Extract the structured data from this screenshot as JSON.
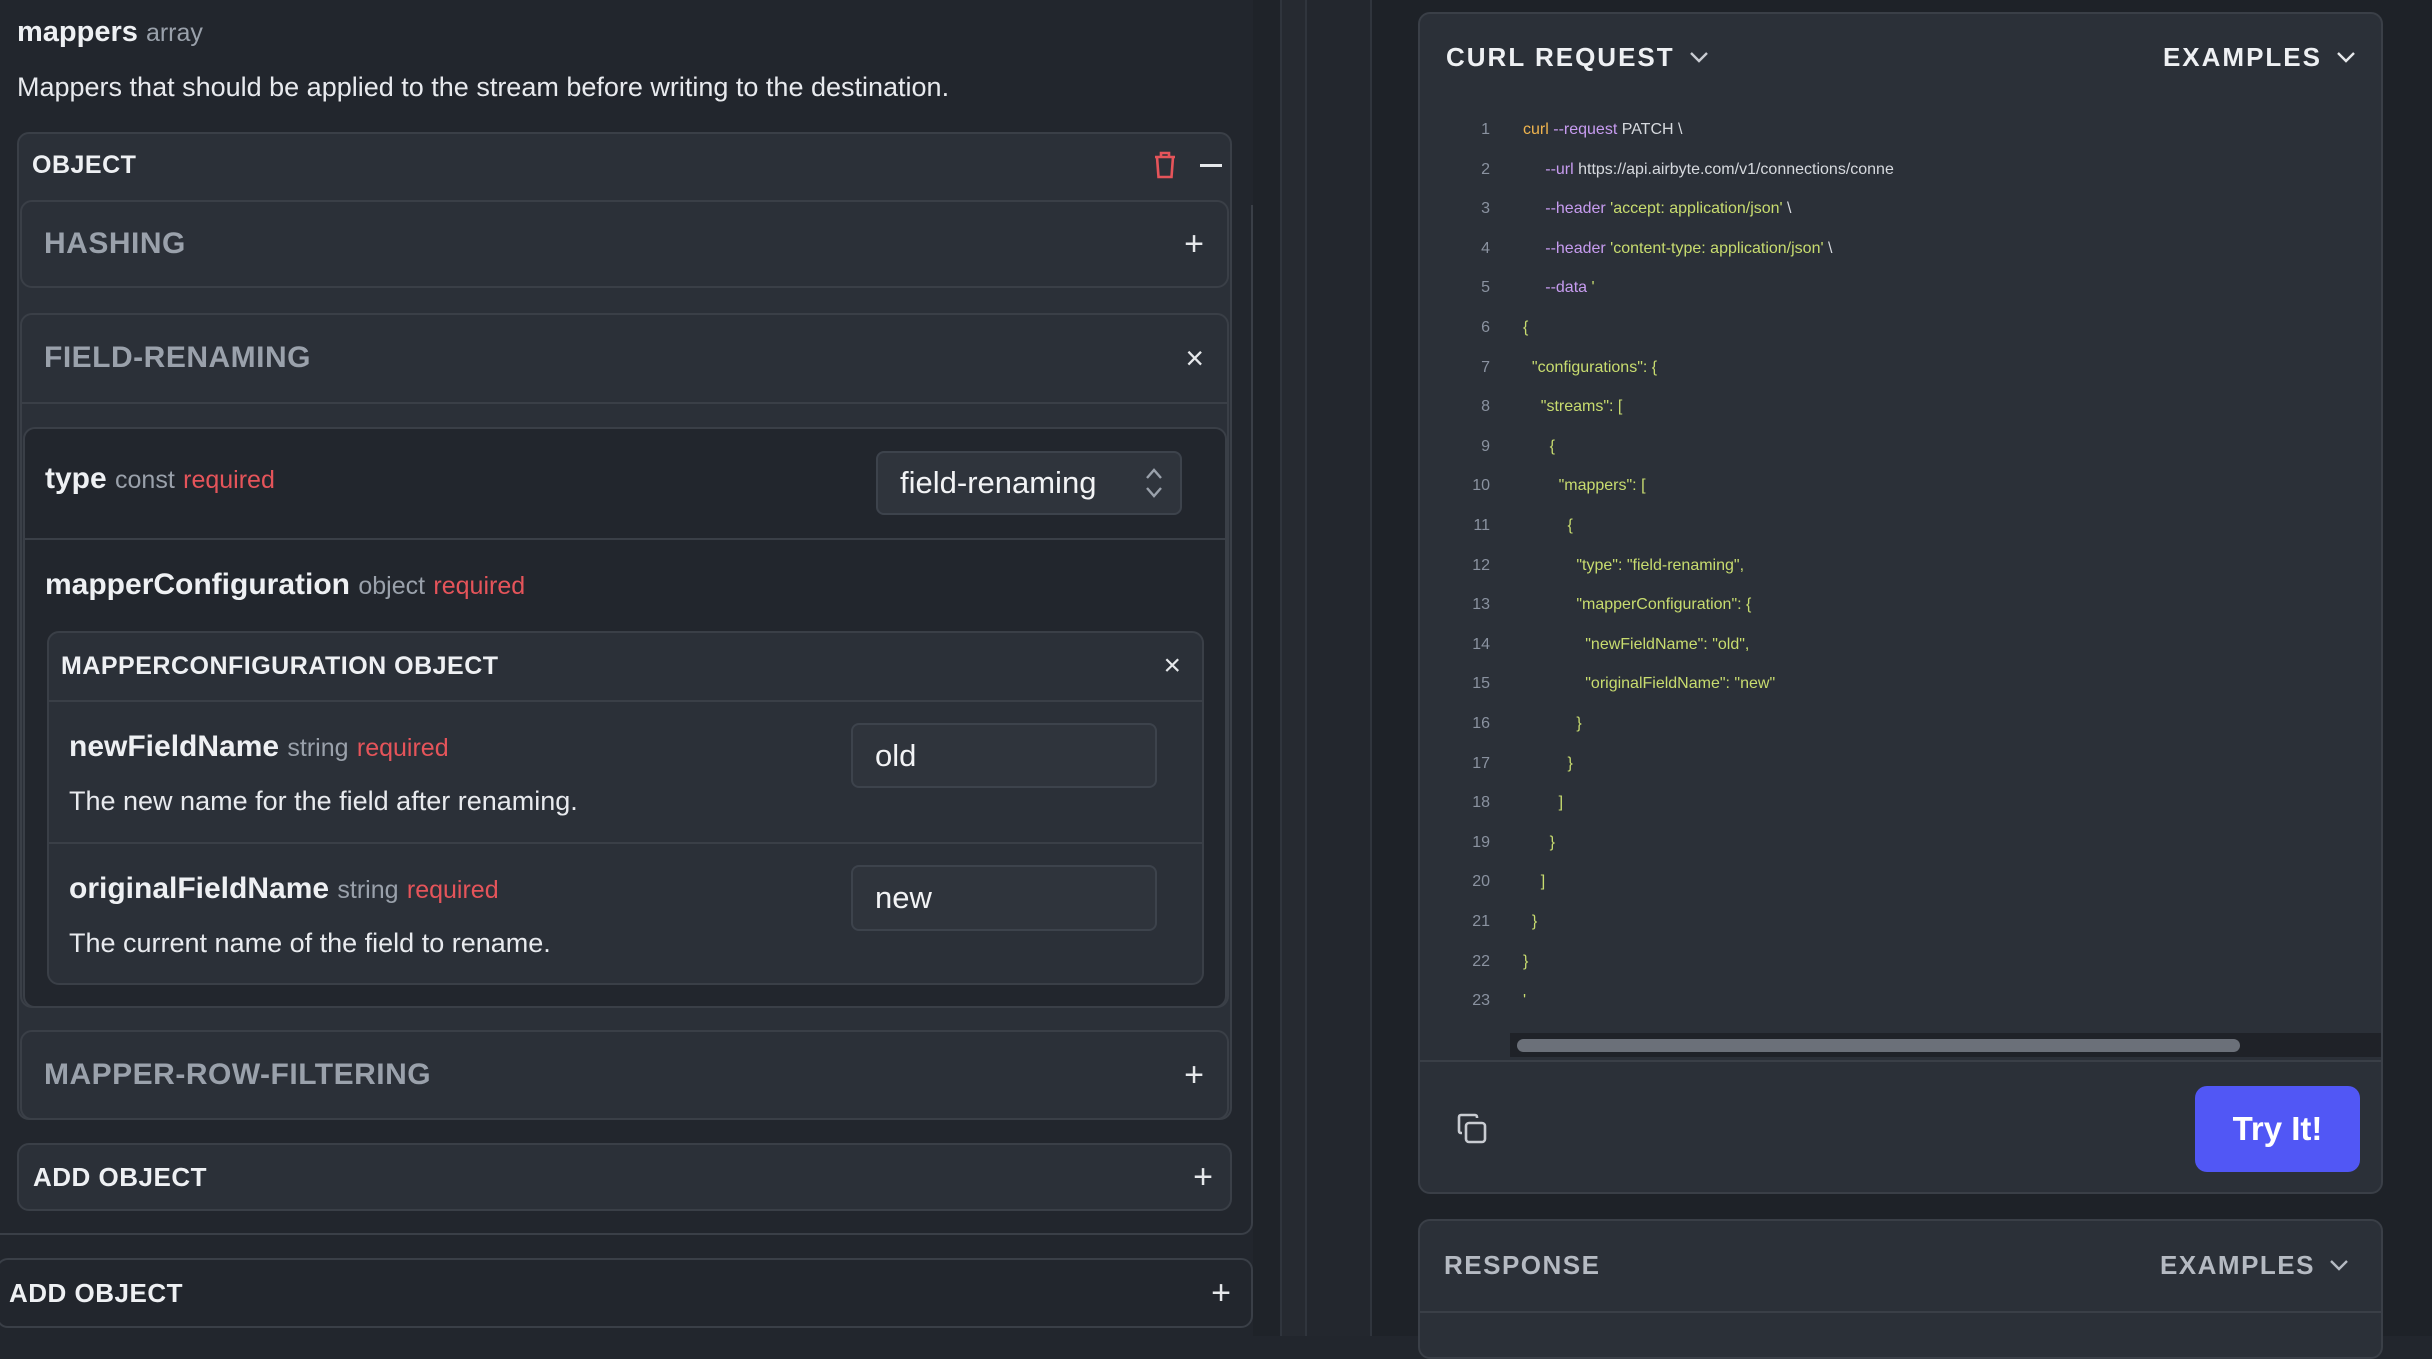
{
  "field": {
    "name": "mappers",
    "type": "array",
    "description": "Mappers that should be applied to the stream before writing to the destination."
  },
  "object": {
    "title": "OBJECT",
    "delete_icon": "trash-icon",
    "collapse_icon": "minus-icon",
    "options": [
      {
        "label": "HASHING",
        "action": "+"
      },
      {
        "label": "FIELD-RENAMING",
        "action": "×"
      },
      {
        "label": "MAPPER-ROW-FILTERING",
        "action": "+"
      }
    ],
    "type_row": {
      "name": "type",
      "type": "const",
      "required": "required",
      "value": "field-renaming"
    },
    "config": {
      "name": "mapperConfiguration",
      "type": "object",
      "required": "required",
      "title": "MAPPERCONFIGURATION OBJECT",
      "fields": [
        {
          "name": "newFieldName",
          "type": "string",
          "required": "required",
          "description": "The new name for the field after renaming.",
          "value": "old"
        },
        {
          "name": "originalFieldName",
          "type": "string",
          "required": "required",
          "description": "The current name of the field to rename.",
          "value": "new"
        }
      ]
    },
    "add_inner": "ADD OBJECT"
  },
  "add_outer": "ADD OBJECT",
  "request": {
    "title": "CURL REQUEST",
    "examples": "EXAMPLES",
    "try_label": "Try It!",
    "copy_icon": "copy-icon",
    "lines": [
      [
        [
          "kw",
          "curl"
        ],
        [
          "plain",
          " "
        ],
        [
          "flag",
          "--request"
        ],
        [
          "plain",
          " PATCH \\"
        ]
      ],
      [
        [
          "plain",
          "     "
        ],
        [
          "flag",
          "--url"
        ],
        [
          "plain",
          " https://api.airbyte.com/v1/connections/conne"
        ]
      ],
      [
        [
          "plain",
          "     "
        ],
        [
          "flag",
          "--header"
        ],
        [
          "plain",
          " "
        ],
        [
          "str",
          "'accept: application/json'"
        ],
        [
          "plain",
          " \\"
        ]
      ],
      [
        [
          "plain",
          "     "
        ],
        [
          "flag",
          "--header"
        ],
        [
          "plain",
          " "
        ],
        [
          "str",
          "'content-type: application/json'"
        ],
        [
          "plain",
          " \\"
        ]
      ],
      [
        [
          "plain",
          "     "
        ],
        [
          "flag",
          "--data"
        ],
        [
          "plain",
          " "
        ],
        [
          "str",
          "'"
        ]
      ],
      [
        [
          "str",
          "{"
        ]
      ],
      [
        [
          "str",
          "  \"configurations\": {"
        ]
      ],
      [
        [
          "str",
          "    \"streams\": ["
        ]
      ],
      [
        [
          "str",
          "      {"
        ]
      ],
      [
        [
          "str",
          "        \"mappers\": ["
        ]
      ],
      [
        [
          "str",
          "          {"
        ]
      ],
      [
        [
          "str",
          "            \"type\": \"field-renaming\","
        ]
      ],
      [
        [
          "str",
          "            \"mapperConfiguration\": {"
        ]
      ],
      [
        [
          "str",
          "              \"newFieldName\": \"old\","
        ]
      ],
      [
        [
          "str",
          "              \"originalFieldName\": \"new\""
        ]
      ],
      [
        [
          "str",
          "            }"
        ]
      ],
      [
        [
          "str",
          "          }"
        ]
      ],
      [
        [
          "str",
          "        ]"
        ]
      ],
      [
        [
          "str",
          "      }"
        ]
      ],
      [
        [
          "str",
          "    ]"
        ]
      ],
      [
        [
          "str",
          "  }"
        ]
      ],
      [
        [
          "str",
          "}"
        ]
      ],
      [
        [
          "str",
          "'"
        ]
      ]
    ]
  },
  "response": {
    "title": "RESPONSE",
    "examples": "EXAMPLES"
  }
}
